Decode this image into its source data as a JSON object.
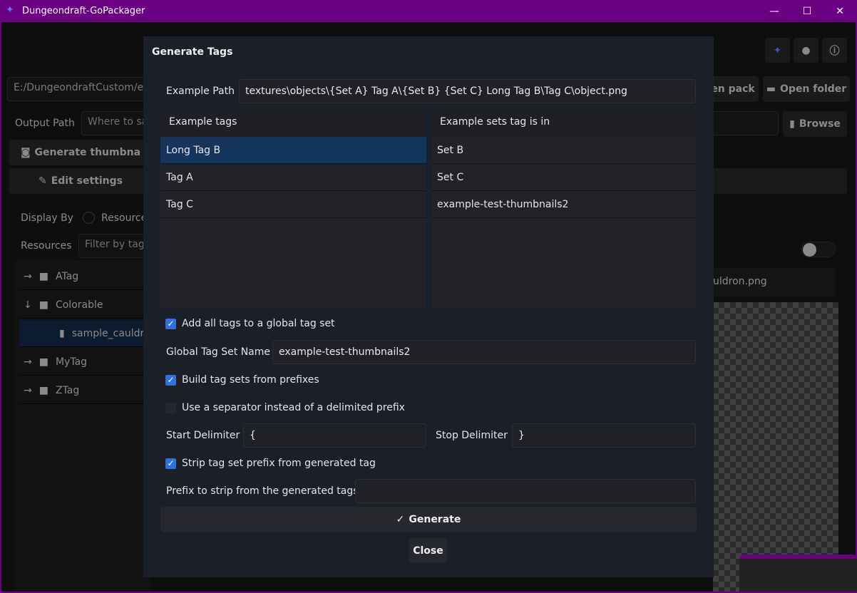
{
  "window": {
    "title": "Dungeondraft-GoPackager",
    "controls": [
      "minimize",
      "maximize",
      "close"
    ]
  },
  "background": {
    "pack_path": "E:/DungeondraftCustom/exa",
    "open_pack_label": "en pack",
    "open_folder_label": "Open folder",
    "output_path_label": "Output Path",
    "output_path_placeholder": "Where to sa",
    "browse_label": "Browse",
    "generate_thumbnails_label": "Generate thumbna",
    "edit_settings_label": "Edit settings",
    "display_by_label": "Display By",
    "display_by_option": "Resource",
    "resources_label": "Resources",
    "filter_placeholder": "Filter by tag n",
    "tree": [
      {
        "label": "ATag",
        "expanded": false
      },
      {
        "label": "Colorable",
        "expanded": true
      },
      {
        "label": "sample_cauldr",
        "file": true,
        "selected": true
      },
      {
        "label": "MyTag",
        "expanded": false
      },
      {
        "label": "ZTag",
        "expanded": false
      }
    ],
    "preview_filename": "uldron.png"
  },
  "dialog": {
    "title": "Generate Tags",
    "example_path_label": "Example Path",
    "example_path_value": "textures\\objects\\{Set A} Tag A\\{Set B} {Set C} Long Tag B\\Tag C\\object.png",
    "tags_header": "Example tags",
    "sets_header": "Example sets tag is in",
    "tags": [
      "Long Tag B",
      "Tag A",
      "Tag C"
    ],
    "sets": [
      "Set B",
      "Set C",
      "example-test-thumbnails2"
    ],
    "add_global_label": "Add all tags to a global tag set",
    "add_global_checked": true,
    "global_name_label": "Global Tag Set Name",
    "global_name_value": "example-test-thumbnails2",
    "build_prefix_label": "Build tag sets from prefixes",
    "build_prefix_checked": true,
    "use_separator_label": "Use a separator instead of a delimited prefix",
    "use_separator_checked": false,
    "start_delim_label": "Start Delimiter",
    "start_delim_value": "{",
    "stop_delim_label": "Stop Delimiter",
    "stop_delim_value": "}",
    "strip_prefix_label": "Strip tag set prefix from generated tag",
    "strip_prefix_checked": true,
    "prefix_strip_label": "Prefix to strip from the generated tags",
    "prefix_strip_value": "",
    "generate_label": "Generate",
    "close_label": "Close"
  },
  "colors": {
    "accent": "#2f6fe0",
    "titlebar": "#6b0083",
    "selection": "#16355c"
  }
}
